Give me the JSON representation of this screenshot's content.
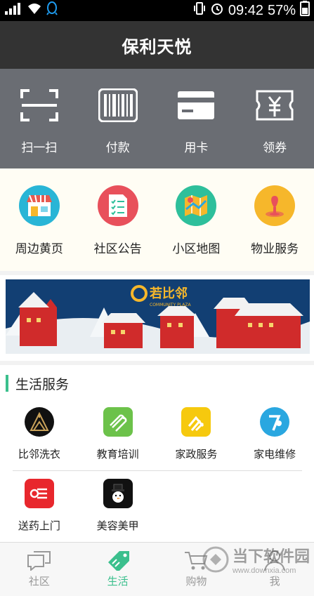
{
  "status": {
    "time": "09:42",
    "battery": "57%"
  },
  "header": {
    "title": "保利天悦"
  },
  "quick_actions": [
    {
      "label": "扫一扫",
      "icon": "scan-icon"
    },
    {
      "label": "付款",
      "icon": "barcode-icon"
    },
    {
      "label": "用卡",
      "icon": "card-icon"
    },
    {
      "label": "领券",
      "icon": "coupon-icon"
    }
  ],
  "shortcuts": [
    {
      "label": "周边黄页",
      "icon": "store-icon",
      "color": "#29b5d6"
    },
    {
      "label": "社区公告",
      "icon": "notice-icon",
      "color": "#e8505b"
    },
    {
      "label": "小区地图",
      "icon": "map-icon",
      "color": "#2ebf9b"
    },
    {
      "label": "物业服务",
      "icon": "property-icon",
      "color": "#f6b72b"
    }
  ],
  "banner": {
    "brand": "若比邻",
    "subtitle": "COMMUNITY PLAZA"
  },
  "services": {
    "title": "生活服务",
    "items": [
      {
        "label": "比邻洗衣",
        "icon": "laundry-icon",
        "color": "#111111"
      },
      {
        "label": "教育培训",
        "icon": "education-icon",
        "color": "#6cc24a"
      },
      {
        "label": "家政服务",
        "icon": "housekeeping-icon",
        "color": "#f6c90e"
      },
      {
        "label": "家电维修",
        "icon": "repair-icon",
        "color": "#2aa7e0"
      },
      {
        "label": "送药上门",
        "icon": "medicine-icon",
        "color": "#e8272d"
      },
      {
        "label": "美容美甲",
        "icon": "beauty-icon",
        "color": "#111111"
      }
    ]
  },
  "tabs": [
    {
      "label": "社区",
      "icon": "chat-icon"
    },
    {
      "label": "生活",
      "icon": "tag-icon"
    },
    {
      "label": "购物",
      "icon": "cart-icon"
    },
    {
      "label": "我",
      "icon": "person-icon"
    }
  ],
  "watermark": {
    "title": "当下软件园",
    "url": "www.downxia.com"
  },
  "colors": {
    "accent": "#3bbf8d",
    "header": "#333333",
    "quickbar": "#6a6d73"
  }
}
